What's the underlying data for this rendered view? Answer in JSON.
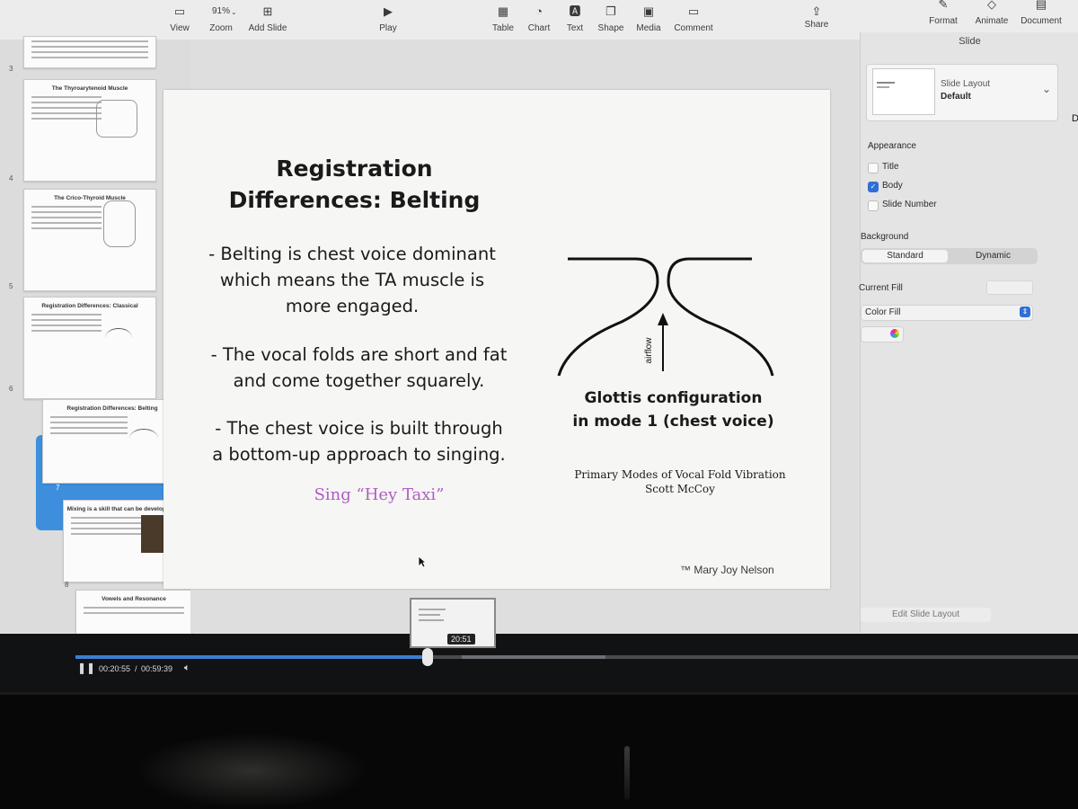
{
  "toolbar": {
    "view": "View",
    "zoom_value": "91%",
    "zoom": "Zoom",
    "add_slide": "Add Slide",
    "play": "Play",
    "table": "Table",
    "chart": "Chart",
    "text": "Text",
    "shape": "Shape",
    "media": "Media",
    "comment": "Comment",
    "share": "Share",
    "format": "Format",
    "animate": "Animate",
    "document": "Document"
  },
  "sidebar": {
    "slides": [
      {
        "num": "3",
        "title": ""
      },
      {
        "num": "4",
        "title": "The Thyroarytenoid Muscle"
      },
      {
        "num": "5",
        "title": "The Crico-Thyroid Muscle"
      },
      {
        "num": "6",
        "title": "Registration Differences: Classical"
      },
      {
        "num": "7",
        "title": "Registration Differences: Belting"
      },
      {
        "num": "8",
        "title": "Mixing is a skill that can be developed early"
      },
      {
        "num": "",
        "title": "Vowels and Resonance"
      }
    ]
  },
  "slide": {
    "title_line1": "Registration",
    "title_line2": "Differences: Belting",
    "bullet1": [
      "- Belting is chest voice dominant",
      "which means the TA muscle is",
      "more engaged."
    ],
    "bullet2": [
      "- The vocal folds are short and fat",
      "and come together squarely."
    ],
    "bullet3": [
      "- The chest voice is built through",
      "a bottom-up approach to singing."
    ],
    "sing": "Sing “Hey Taxi”",
    "diagram_airflow": "airflow",
    "caption_line1": "Glottis configuration",
    "caption_line2": "in mode 1 (chest voice)",
    "source_line1": "Primary Modes of Vocal Fold Vibration",
    "source_line2": "Scott McCoy",
    "credit": "™ Mary Joy Nelson"
  },
  "inspector": {
    "header": "Slide",
    "layout_label": "Slide Layout",
    "layout_value": "Default",
    "appearance": "Appearance",
    "title": "Title",
    "body": "Body",
    "slide_number": "Slide Number",
    "background": "Background",
    "standard": "Standard",
    "dynamic": "Dynamic",
    "current_fill": "Current Fill",
    "color_fill": "Color Fill",
    "edit_layout": "Edit Slide Layout",
    "partial_right": "Dr"
  },
  "video": {
    "preview_time": "20:51",
    "current": "00:20:55",
    "separator": "/",
    "total": "00:59:39",
    "progress": 0.351
  },
  "colors": {
    "accent": "#3d8fde",
    "sing_text": "#b05cc4"
  }
}
